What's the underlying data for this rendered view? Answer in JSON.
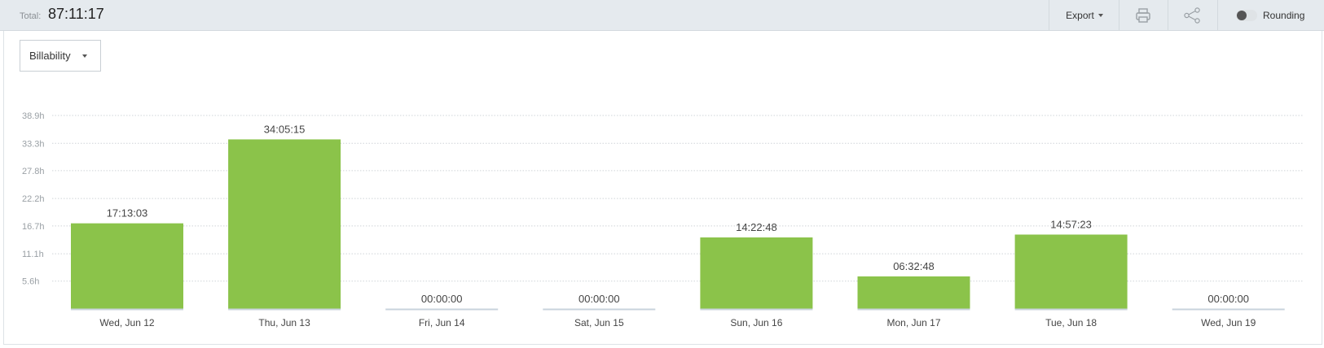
{
  "header": {
    "total_label": "Total:",
    "total_value": "87:11:17",
    "export_label": "Export",
    "rounding_label": "Rounding",
    "rounding_on": false
  },
  "filter": {
    "selected": "Billability"
  },
  "colors": {
    "bar": "#8bc34a",
    "baseline": "#c8d3dc",
    "grid": "#cfd4d8",
    "axis_text": "#9aa0a5"
  },
  "icons": {
    "print": "printer-icon",
    "share": "share-icon"
  },
  "chart_data": {
    "type": "bar",
    "categories": [
      "Wed, Jun 12",
      "Thu, Jun 13",
      "Fri, Jun 14",
      "Sat, Jun 15",
      "Sun, Jun 16",
      "Mon, Jun 17",
      "Tue, Jun 18",
      "Wed, Jun 19"
    ],
    "values": [
      17.218,
      34.088,
      0,
      0,
      14.38,
      6.547,
      14.956,
      0
    ],
    "data_labels": [
      "17:13:03",
      "34:05:15",
      "00:00:00",
      "00:00:00",
      "14:22:48",
      "06:32:48",
      "14:57:23",
      "00:00:00"
    ],
    "yticks": [
      5.6,
      11.1,
      16.7,
      22.2,
      27.8,
      33.3,
      38.9
    ],
    "ytick_labels": [
      "5.6h",
      "11.1h",
      "16.7h",
      "22.2h",
      "27.8h",
      "33.3h",
      "38.9h"
    ],
    "ylim": [
      0,
      38.9
    ],
    "grid": true,
    "legend": "none",
    "title": "",
    "xlabel": "",
    "ylabel": ""
  }
}
